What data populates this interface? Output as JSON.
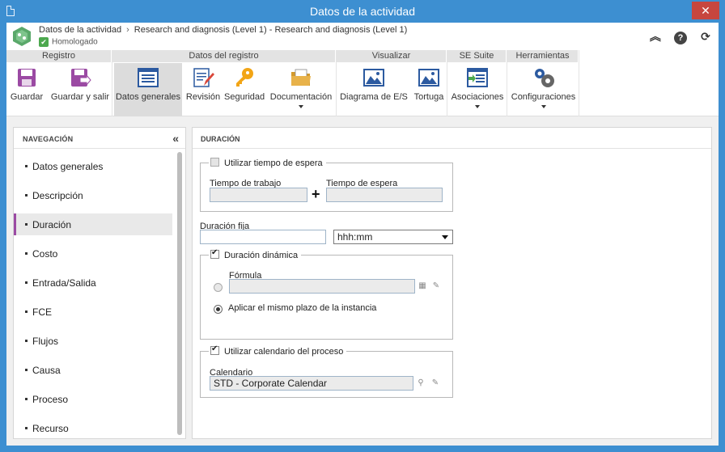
{
  "window": {
    "title": "Datos de la actividad",
    "close": "✕"
  },
  "header": {
    "breadcrumb": [
      "Datos de la actividad",
      "Research and diagnosis (Level 1) - Research and diagnosis (Level 1)"
    ],
    "breadcrumb_sep": "›",
    "status": "Homologado",
    "icons": {
      "collapse": "«",
      "help": "?",
      "refresh": "⟳"
    }
  },
  "ribbon": {
    "groups": [
      {
        "title": "Registro"
      },
      {
        "title": "Datos del registro"
      },
      {
        "title": "Visualizar"
      },
      {
        "title": "SE Suite"
      },
      {
        "title": "Herramientas"
      }
    ],
    "buttons": {
      "save": "Guardar",
      "save_exit": "Guardar y salir",
      "general": "Datos generales",
      "revision": "Revisión",
      "security": "Seguridad",
      "documentation": "Documentación",
      "io_diagram": "Diagrama de E/S",
      "turtle": "Tortuga",
      "associations": "Asociaciones",
      "settings": "Configuraciones"
    }
  },
  "nav": {
    "title": "NAVEGACIÓN",
    "collapse_icon": "«",
    "items": [
      "Datos generales",
      "Descripción",
      "Duración",
      "Costo",
      "Entrada/Salida",
      "FCE",
      "Flujos",
      "Causa",
      "Proceso",
      "Recurso"
    ],
    "selected_index": 2
  },
  "content": {
    "title": "DURACIÓN",
    "wait_time": {
      "legend": "Utilizar tiempo de espera",
      "checked": false,
      "work_time_label": "Tiempo de trabajo",
      "work_time_value": "",
      "plus": "+",
      "wait_time_label": "Tiempo de espera",
      "wait_time_value": ""
    },
    "fixed_duration": {
      "label": "Duración fija",
      "value": "",
      "unit": "hhh:mm"
    },
    "dynamic_duration": {
      "legend": "Duración dinámica",
      "checked": true,
      "formula_label": "Fórmula",
      "formula_value": "",
      "same_term_label": "Aplicar el mismo plazo de la instancia"
    },
    "calendar": {
      "legend": "Utilizar calendario del proceso",
      "checked": true,
      "label": "Calendario",
      "value": "STD - Corporate Calendar"
    }
  },
  "colors": {
    "titlebar": "#3d8fd1",
    "close": "#c7463e",
    "accent": "#9b4aa3",
    "status_green": "#4ca84e"
  }
}
